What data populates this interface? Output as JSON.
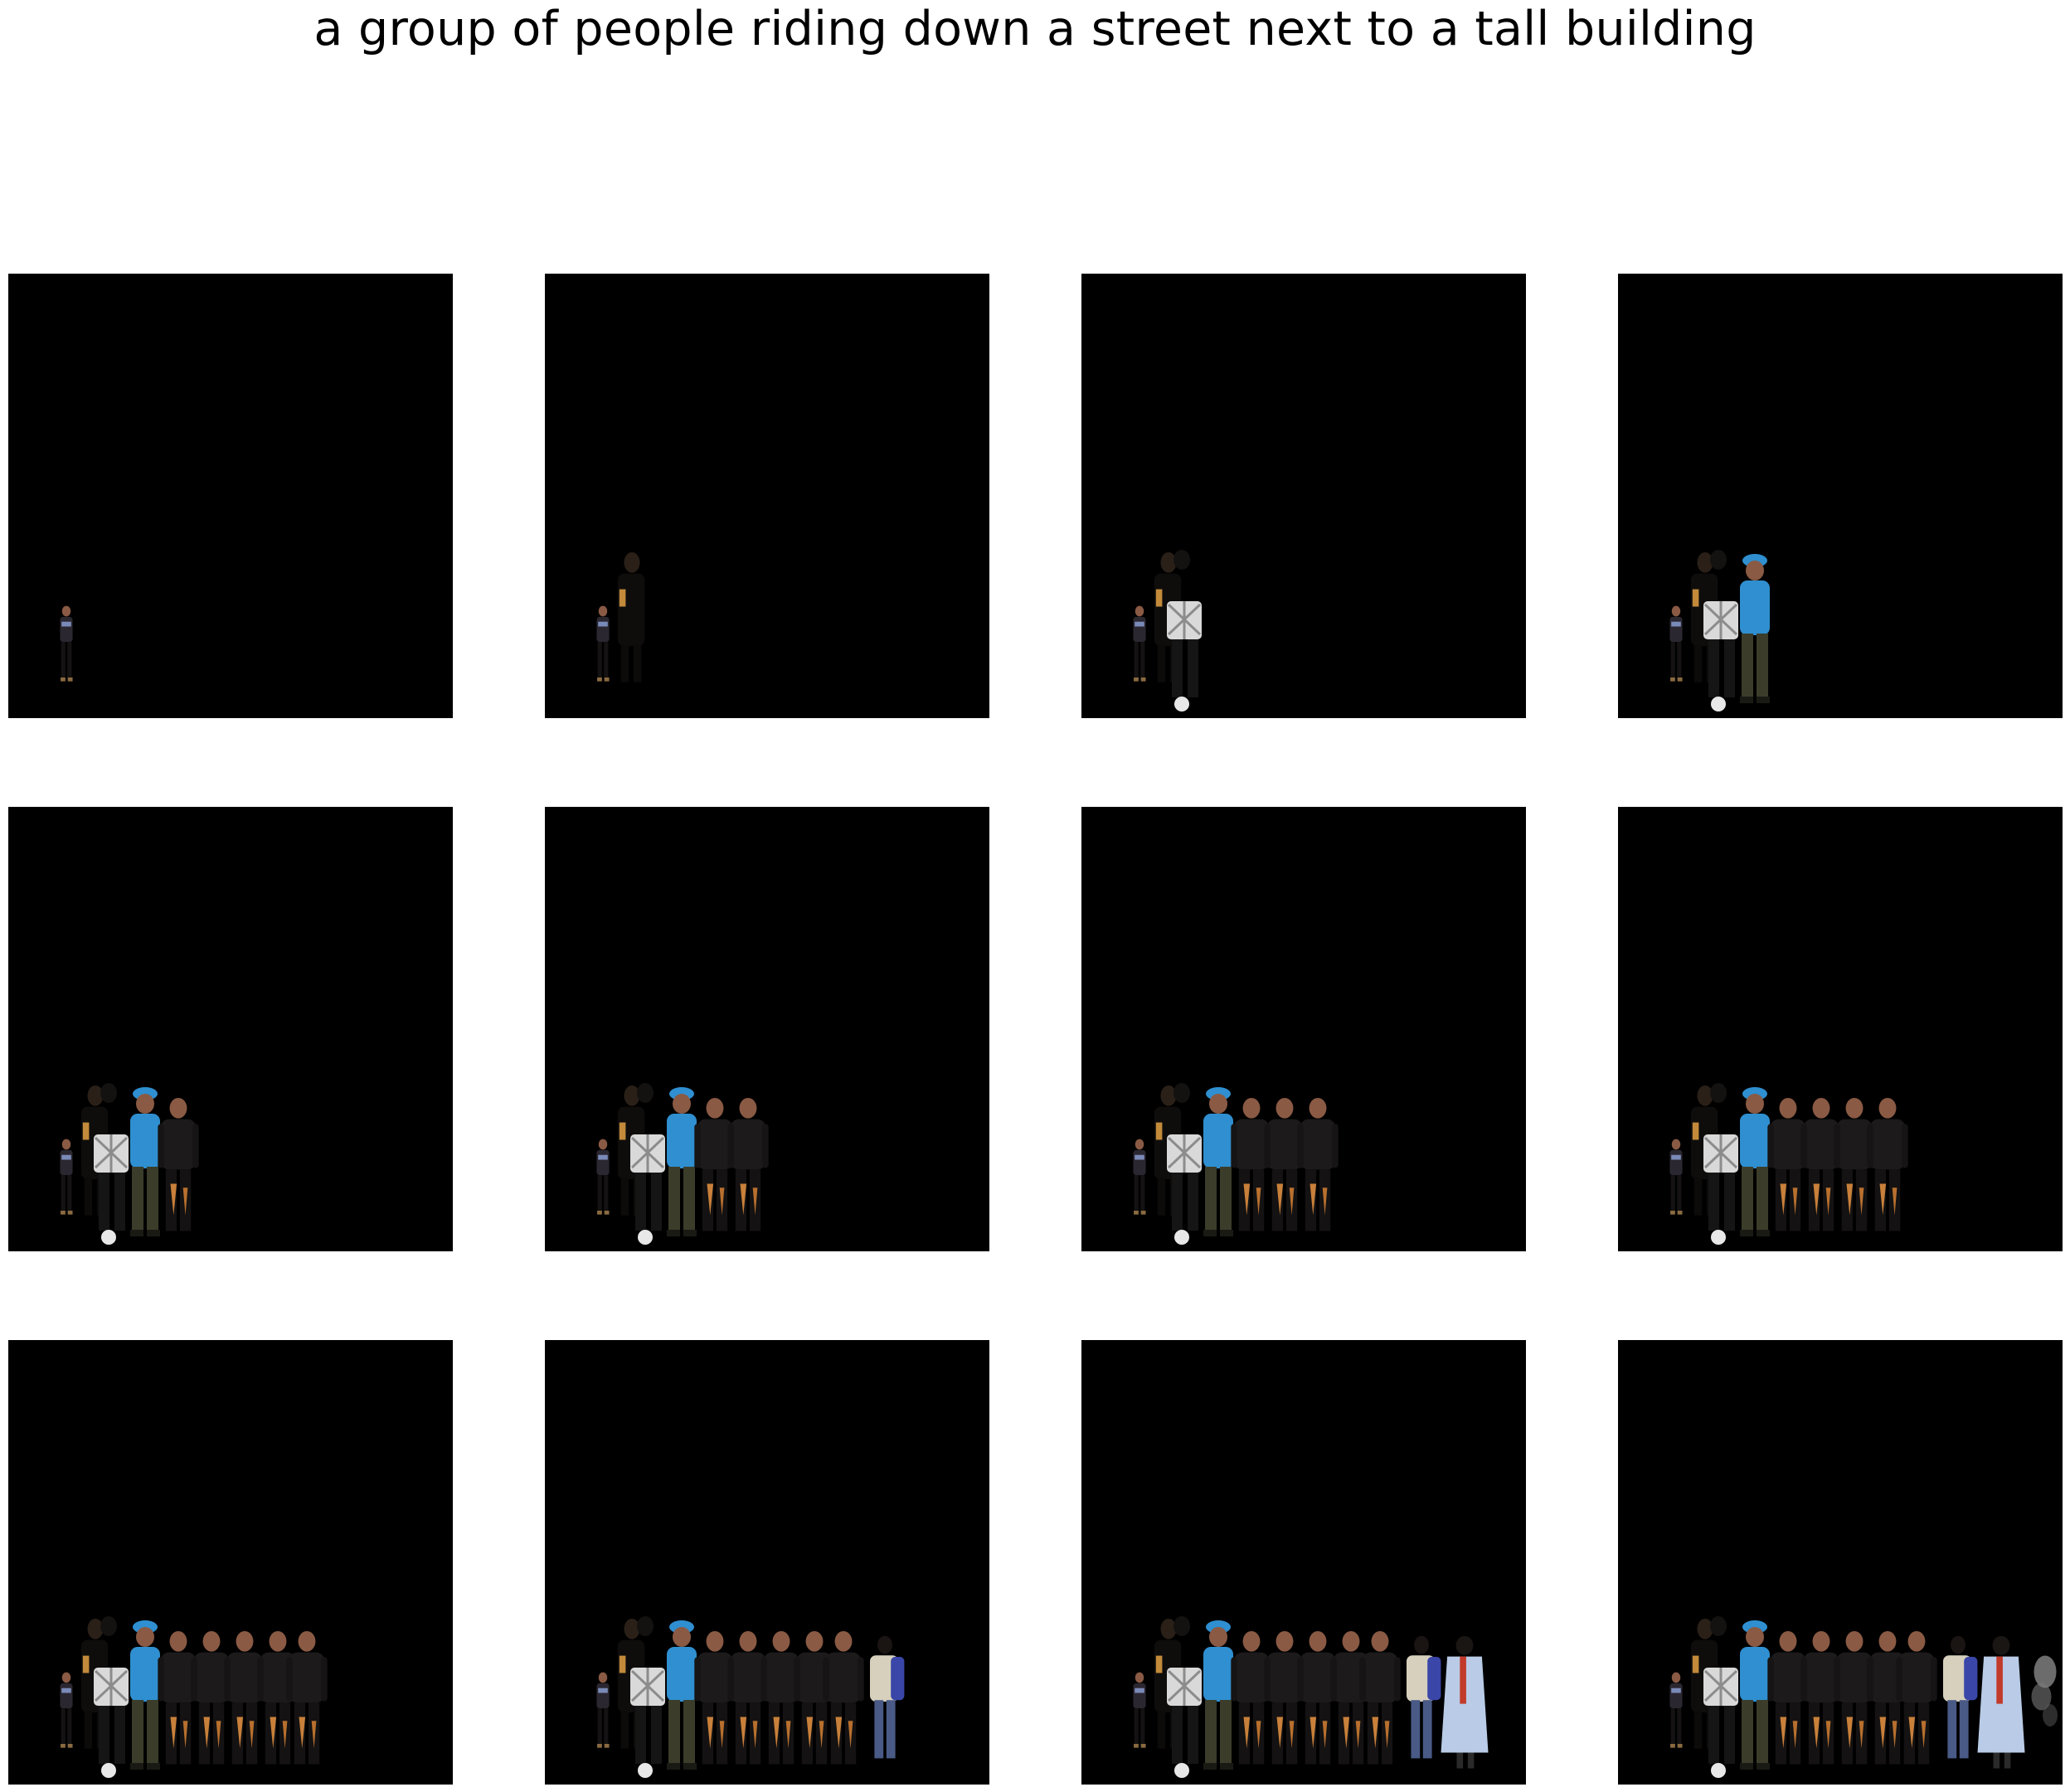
{
  "caption": "a group of people riding down a street next to a tall building",
  "frames": [
    {
      "index": 1,
      "figures": [
        "person"
      ]
    },
    {
      "index": 2,
      "figures": [
        "person",
        "person"
      ]
    },
    {
      "index": 3,
      "figures": [
        "person",
        "person",
        "person"
      ]
    },
    {
      "index": 4,
      "figures": [
        "person",
        "person",
        "person",
        "person"
      ]
    },
    {
      "index": 5,
      "figures": [
        "person",
        "person",
        "person",
        "person",
        "person"
      ]
    },
    {
      "index": 6,
      "figures": [
        "person",
        "person",
        "person",
        "person",
        "person",
        "person"
      ]
    },
    {
      "index": 7,
      "figures": [
        "person",
        "person",
        "person",
        "person",
        "person",
        "person",
        "person"
      ]
    },
    {
      "index": 8,
      "figures": [
        "person",
        "person",
        "person",
        "person",
        "person",
        "person",
        "person",
        "person"
      ]
    },
    {
      "index": 9,
      "figures": [
        "person",
        "person",
        "person",
        "person",
        "person",
        "person",
        "person",
        "person",
        "person"
      ]
    },
    {
      "index": 10,
      "figures": [
        "person",
        "person",
        "person",
        "person",
        "person",
        "person",
        "person",
        "person",
        "person",
        "person"
      ]
    },
    {
      "index": 11,
      "figures": [
        "person",
        "person",
        "person",
        "person",
        "person",
        "person",
        "person",
        "person",
        "person",
        "person",
        "person"
      ]
    },
    {
      "index": 12,
      "figures": [
        "person",
        "person",
        "person",
        "person",
        "person",
        "person",
        "person",
        "person",
        "person",
        "person",
        "person",
        "person"
      ]
    }
  ],
  "colors": {
    "background": "#000000",
    "page": "#ffffff",
    "blue_shirt": "#2f8fd0",
    "white_shirt": "#d9d9d9",
    "dark_uniform": "#1c1a1a",
    "olive_pants": "#3b3d2a",
    "light_coat": "#b9cbe6",
    "red_scarf": "#c23a2a",
    "skin": "#8a5a44"
  }
}
